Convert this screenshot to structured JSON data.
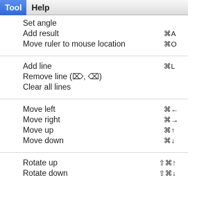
{
  "menubar": {
    "tool_label": "Tool",
    "help_label": "Help"
  },
  "menu": {
    "group1": [
      {
        "label": "Set angle",
        "shortcut": ""
      },
      {
        "label": "Add result",
        "shortcut": "⌘A"
      },
      {
        "label": "Move ruler to mouse location",
        "shortcut": "⌘O"
      }
    ],
    "group2": [
      {
        "label": "Add line",
        "shortcut": "⌘L"
      },
      {
        "label": "Remove line (⌦, ⌫)",
        "shortcut": ""
      },
      {
        "label": "Clear all lines",
        "shortcut": ""
      }
    ],
    "group3": [
      {
        "label": "Move left",
        "shortcut": "⌘←"
      },
      {
        "label": "Move right",
        "shortcut": "⌘→"
      },
      {
        "label": "Move up",
        "shortcut": "⌘↑"
      },
      {
        "label": "Move down",
        "shortcut": "⌘↓"
      }
    ],
    "group4": [
      {
        "label": "Rotate up",
        "shortcut": "⇧⌘↑"
      },
      {
        "label": "Rotate down",
        "shortcut": "⇧⌘↓"
      }
    ]
  }
}
